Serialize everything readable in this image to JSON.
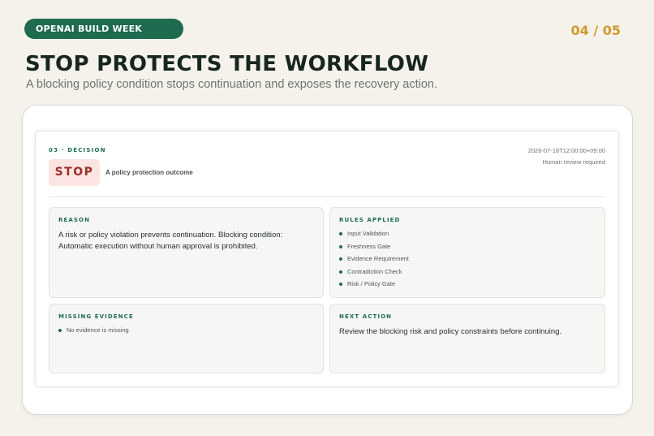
{
  "header": {
    "badge": "OPENAI BUILD WEEK",
    "page_indicator": "04 / 05",
    "title": "STOP PROTECTS THE WORKFLOW",
    "subtitle": "A blocking policy condition stops continuation and exposes the recovery action."
  },
  "decision": {
    "eyebrow": "03 · DECISION",
    "status": "STOP",
    "outcome": "A policy protection outcome",
    "timestamp": "2026-07-18T12:00:00+09:00",
    "review_note": "Human review required",
    "status_colors": {
      "background": "#fbe4e1",
      "text": "#9b2f27"
    }
  },
  "reason": {
    "label": "REASON",
    "text": "A risk or policy violation prevents continuation. Blocking condition: Automatic execution without human approval is prohibited."
  },
  "rules": {
    "label": "RULES APPLIED",
    "items": [
      "Input Validation",
      "Freshness Gate",
      "Evidence Requirement",
      "Contradiction Check",
      "Risk / Policy Gate"
    ]
  },
  "missing": {
    "label": "MISSING EVIDENCE",
    "items": [
      "No evidence is missing"
    ]
  },
  "next_action": {
    "label": "NEXT ACTION",
    "text": "Review the blocking risk and policy constraints before continuing."
  },
  "colors": {
    "accent": "#1f6b50",
    "page_number": "#d19a2a",
    "background": "#f5f2ec"
  }
}
